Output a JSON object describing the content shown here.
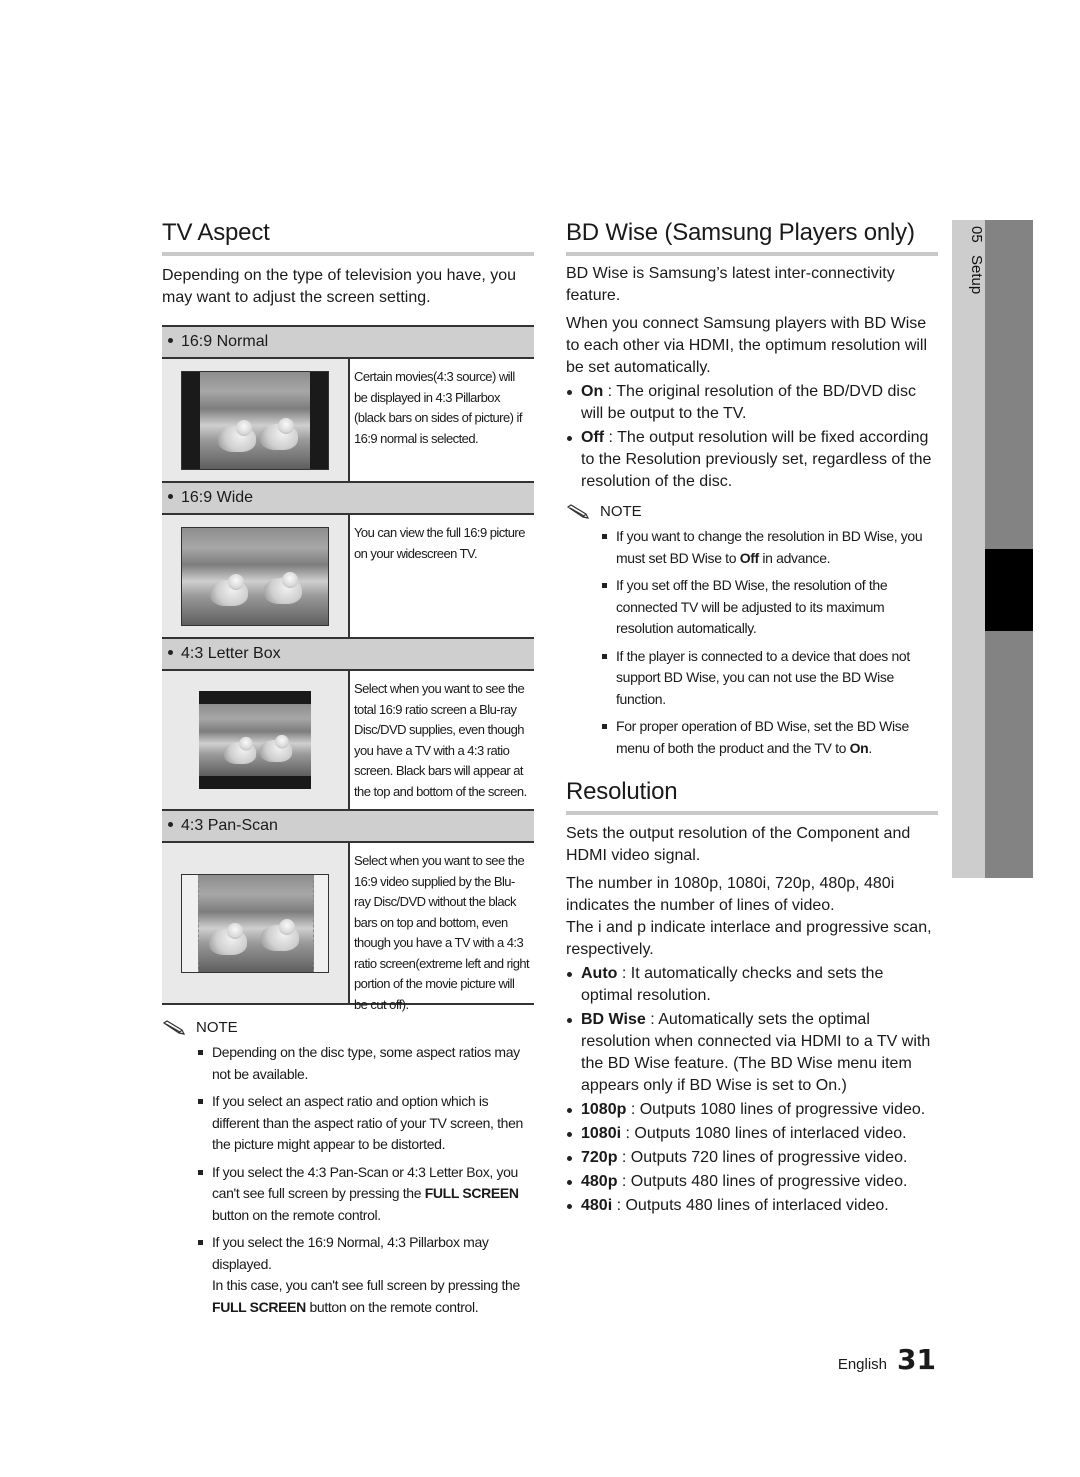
{
  "left": {
    "title": "TV Aspect",
    "intro": "Depending on the type of television you have, you may want to adjust the screen setting.",
    "options": [
      {
        "label": "16:9 Normal",
        "description": "Certain movies(4:3 source) will be displayed in 4:3 Pillarbox (black bars on sides of picture) if 16:9 normal is selected.",
        "image": "pillarbox-puppies"
      },
      {
        "label": "16:9 Wide",
        "description": "You can view the full 16:9 picture on your widescreen TV.",
        "image": "wide-puppies"
      },
      {
        "label": "4:3 Letter Box",
        "description": "Select when you want to see the total 16:9 ratio screen a Blu-ray Disc/DVD supplies, even though you have a TV with a 4:3 ratio screen. Black bars will appear at the top and bottom of the screen.",
        "image": "letterbox-puppies"
      },
      {
        "label": "4:3 Pan-Scan",
        "description": "Select when you want to see the 16:9 video supplied by the Blu-ray Disc/DVD without the black bars on top and bottom, even though you have a TV with a 4:3 ratio screen(extreme left and right portion of the movie picture will be cut off).",
        "image": "panscan-puppies"
      }
    ],
    "note_label": "NOTE",
    "notes": [
      {
        "text": "Depending on the disc type, some aspect ratios may not be available."
      },
      {
        "text": "If you select an aspect ratio and option which is different than the aspect ratio of your TV screen, then the picture might appear to be distorted."
      },
      {
        "pre": "If you select the 4:3 Pan-Scan or 4:3 Letter Box, you can't see full screen by pressing the ",
        "bold": "FULL SCREEN",
        "post": " button on the remote control."
      },
      {
        "pre": "If you select the 16:9 Normal, 4:3 Pillarbox may displayed.",
        "line2_pre": "In this case, you can't see full screen by pressing the ",
        "bold": "FULL SCREEN",
        "post": " button on the remote control."
      }
    ]
  },
  "right": {
    "bdwise": {
      "title": "BD Wise (Samsung Players only)",
      "para1": "BD Wise is Samsung’s latest inter-connectivity feature.",
      "para2": "When you connect Samsung players with BD Wise to each other via HDMI, the optimum resolution will be set automatically.",
      "items": [
        {
          "term": "On",
          "text": " : The original resolution of the BD/DVD disc will be output to the TV."
        },
        {
          "term": "Off",
          "text": " : The output resolution will be fixed according to the Resolution previously set, regardless of the resolution of the disc."
        }
      ],
      "note_label": "NOTE",
      "notes": [
        {
          "pre": "If you want to change the resolution in BD Wise, you must set BD Wise to ",
          "bold": "Off",
          "post": " in advance."
        },
        {
          "pre": "If you set off the BD Wise, the resolution of the connected TV will be adjusted to its maximum resolution automatically.",
          "bold": "",
          "post": ""
        },
        {
          "pre": "If the player is connected to a device that does not support BD Wise, you can not use the BD Wise function.",
          "bold": "",
          "post": ""
        },
        {
          "pre": "For proper operation of BD Wise, set the BD Wise menu of both the product and the TV to ",
          "bold": "On",
          "post": "."
        }
      ]
    },
    "resolution": {
      "title": "Resolution",
      "para1": "Sets the output resolution of the Component and HDMI video signal.",
      "para2": "The number in 1080p, 1080i, 720p, 480p, 480i indicates the number of lines of video.",
      "para3": "The i and p indicate interlace and progressive scan, respectively.",
      "items": [
        {
          "term": "Auto",
          "text": " : It automatically checks and sets the optimal resolution."
        },
        {
          "term": "BD Wise",
          "text": " : Automatically sets the optimal resolution when connected via HDMI to a TV with the BD Wise feature. (The BD Wise menu item appears only if BD Wise is set to On.)"
        },
        {
          "term": "1080p",
          "text": " : Outputs 1080 lines of progressive video."
        },
        {
          "term": "1080i",
          "text": " : Outputs 1080 lines of interlaced video."
        },
        {
          "term": "720p",
          "text": " : Outputs 720 lines of progressive video."
        },
        {
          "term": "480p",
          "text": " : Outputs 480 lines of progressive video."
        },
        {
          "term": "480i",
          "text": " : Outputs 480 lines of interlaced video."
        }
      ]
    }
  },
  "side_tab": {
    "number": "05",
    "label": "Setup"
  },
  "footer": {
    "language": "English",
    "page_number": "31"
  }
}
